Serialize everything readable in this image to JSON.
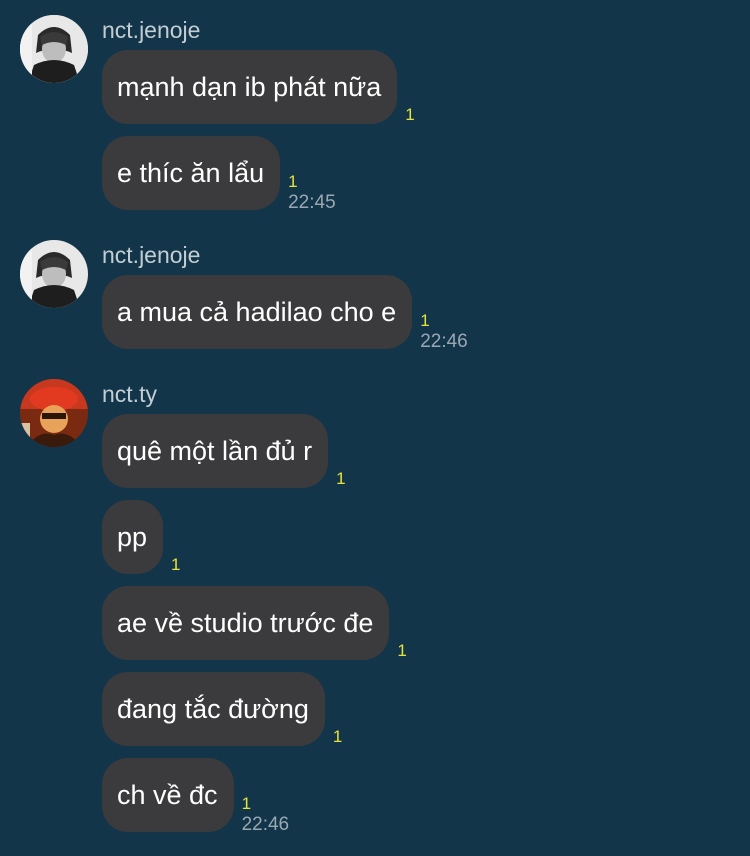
{
  "groups": [
    {
      "sender": "nct.jenoje",
      "messages": [
        {
          "text": "mạnh dạn ib phát nữa",
          "read": "1",
          "time": ""
        },
        {
          "text": "e thíc ăn lẩu",
          "read": "1",
          "time": "22:45"
        }
      ]
    },
    {
      "sender": "nct.jenoje",
      "messages": [
        {
          "text": "a mua cả hadilao cho e",
          "read": "1",
          "time": "22:46"
        }
      ]
    },
    {
      "sender": "nct.ty",
      "messages": [
        {
          "text": "quê một lần đủ r",
          "read": "1",
          "time": ""
        },
        {
          "text": "pp",
          "read": "1",
          "time": ""
        },
        {
          "text": "ae về studio trước đe",
          "read": "1",
          "time": ""
        },
        {
          "text": "đang tắc đường",
          "read": "1",
          "time": ""
        },
        {
          "text": "ch về đc",
          "read": "1",
          "time": "22:46"
        }
      ]
    }
  ],
  "colors": {
    "background": "#133549",
    "bubble": "#3b3b3d",
    "read_count": "#e6e23a"
  },
  "icons": [
    "avatar-jenoje-photo",
    "avatar-ty-photo"
  ]
}
